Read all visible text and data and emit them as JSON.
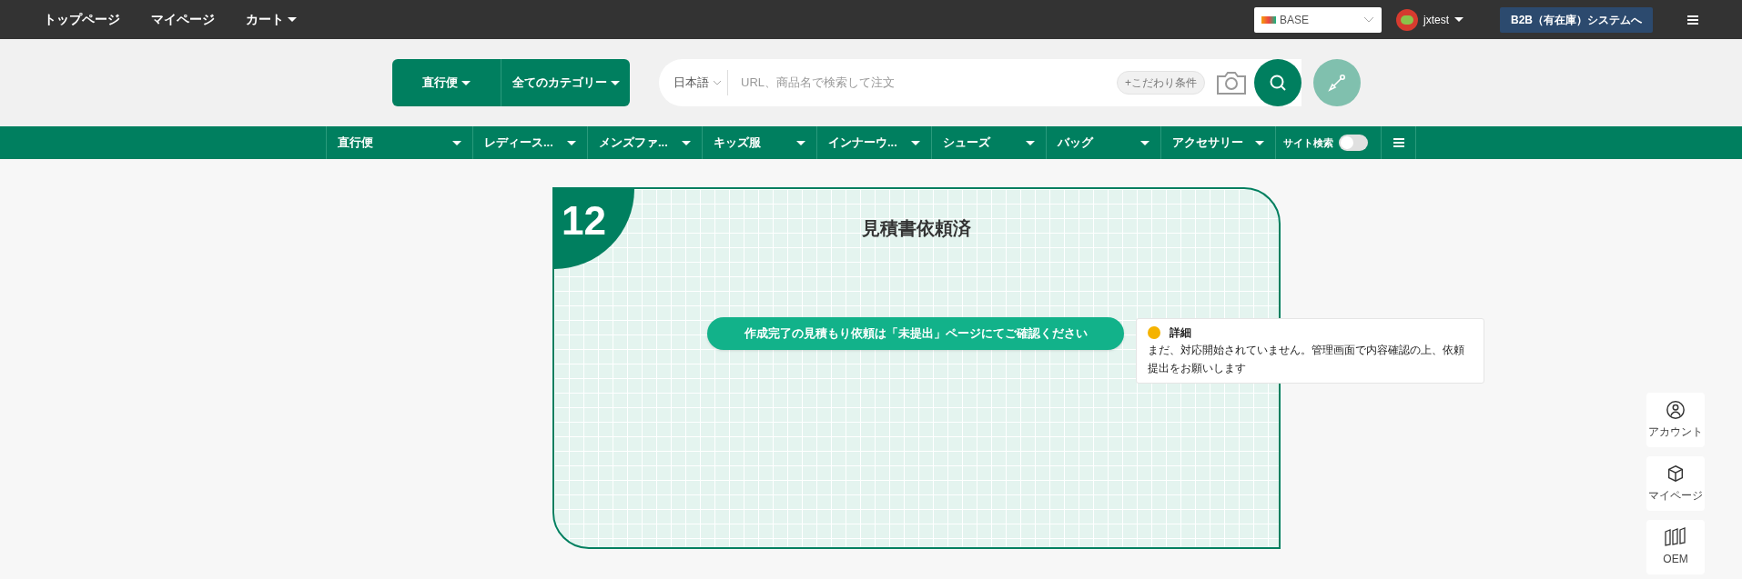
{
  "top_nav": {
    "links": [
      {
        "label": "トップページ",
        "dropdown": false
      },
      {
        "label": "マイページ",
        "dropdown": false
      },
      {
        "label": "カート",
        "dropdown": true
      }
    ],
    "store_select": {
      "value": "BASE"
    },
    "user": {
      "name": "jxtest"
    },
    "system_button": "B2B（有在庫）システムへ"
  },
  "search_bar": {
    "shipping": "直行便",
    "category": "全てのカテゴリー",
    "language": "日本語",
    "placeholder": "URL、商品名で検索して注文",
    "filter": "+こだわり条件"
  },
  "category_nav": [
    {
      "kind": "dropdown",
      "label": "直行便"
    },
    {
      "kind": "dropdown",
      "label": "レディース..."
    },
    {
      "kind": "dropdown",
      "label": "メンズファ..."
    },
    {
      "kind": "dropdown",
      "label": "キッズ服"
    },
    {
      "kind": "dropdown",
      "label": "インナーウ..."
    },
    {
      "kind": "dropdown",
      "label": "シューズ"
    },
    {
      "kind": "dropdown",
      "label": "バッグ"
    },
    {
      "kind": "dropdown",
      "label": "アクセサリー"
    },
    {
      "kind": "toggle",
      "label": "サイト検索",
      "on": false
    },
    {
      "kind": "menu"
    }
  ],
  "status_card": {
    "number": "12",
    "title": "見積書依頼済",
    "action": "作成完了の見積もり依頼は「未提出」ページにてご確認ください",
    "tooltip": {
      "title": "詳細",
      "text": "まだ、対応開始されていません。管理画面で内容確認の上、依頼提出をお願いします"
    }
  },
  "side_buttons": [
    {
      "kind": "account",
      "label": "アカウント"
    },
    {
      "kind": "mypage",
      "label": "マイページ"
    },
    {
      "kind": "oem",
      "label": "OEM"
    }
  ]
}
